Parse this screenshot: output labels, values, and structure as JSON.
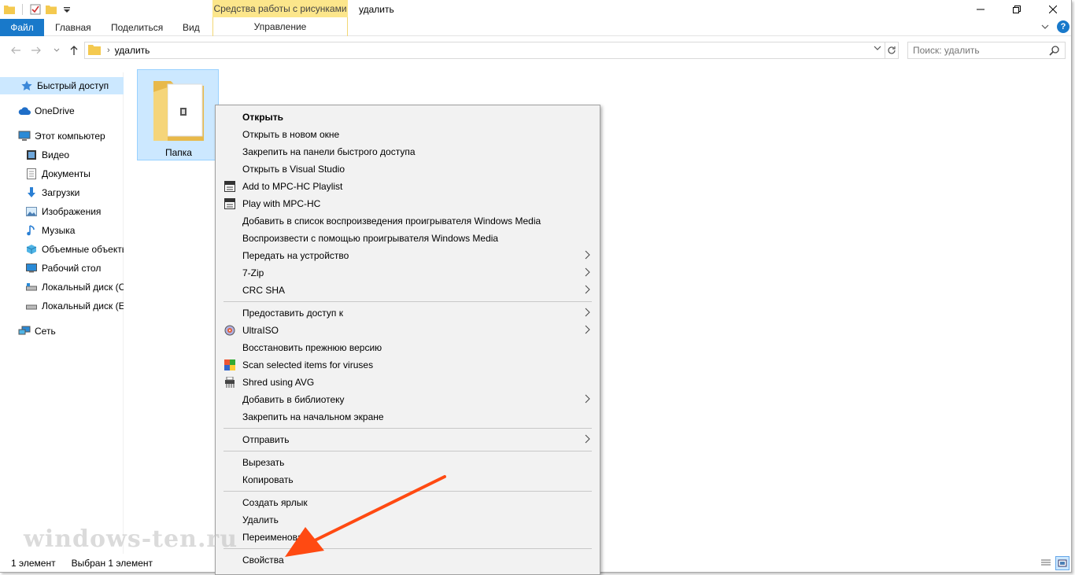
{
  "colors": {
    "accent": "#1979ca",
    "context_tab": "#fce68b",
    "selection": "#cce8ff",
    "menu_bg": "#f2f2f2",
    "annotation_arrow": "#ff4a12"
  },
  "titlebar": {
    "qat_icons": [
      "folder-icon",
      "properties-checkmark-icon",
      "new-folder-icon",
      "customize-qat-dropdown-icon"
    ],
    "context_tab_group": "Средства работы с рисунками",
    "title": "удалить",
    "window_buttons": [
      "minimize-icon",
      "maximize-icon",
      "close-icon"
    ]
  },
  "ribbon": {
    "file_tab": "Файл",
    "tabs": [
      "Главная",
      "Поделиться",
      "Вид"
    ],
    "context_tab": "Управление"
  },
  "address_bar": {
    "path": "удалить",
    "search_placeholder": "Поиск: удалить"
  },
  "sidebar": {
    "items": [
      {
        "label": "Быстрый доступ",
        "icon": "star-icon"
      },
      {
        "label": "OneDrive",
        "icon": "cloud-icon"
      },
      {
        "label": "Этот компьютер",
        "icon": "computer-icon"
      },
      {
        "label": "Видео",
        "icon": "video-icon"
      },
      {
        "label": "Документы",
        "icon": "documents-icon"
      },
      {
        "label": "Загрузки",
        "icon": "downloads-icon"
      },
      {
        "label": "Изображения",
        "icon": "pictures-icon"
      },
      {
        "label": "Музыка",
        "icon": "music-icon"
      },
      {
        "label": "Объемные объекты",
        "icon": "3d-objects-icon"
      },
      {
        "label": "Рабочий стол",
        "icon": "desktop-icon"
      },
      {
        "label": "Локальный диск (C:)",
        "icon": "drive-icon"
      },
      {
        "label": "Локальный диск (E:)",
        "icon": "drive-icon"
      },
      {
        "label": "Сеть",
        "icon": "network-icon"
      }
    ]
  },
  "content": {
    "items": [
      {
        "name": "Папка",
        "icon": "folder-icon",
        "selected": true
      }
    ]
  },
  "context_menu": {
    "items": [
      {
        "label": "Открыть",
        "bold": true
      },
      {
        "label": "Открыть в новом окне"
      },
      {
        "label": "Закрепить на панели быстрого доступа"
      },
      {
        "label": "Открыть в Visual Studio"
      },
      {
        "label": "Add to MPC-HC Playlist",
        "icon": "mpc-hc-icon"
      },
      {
        "label": "Play with MPC-HC",
        "icon": "mpc-hc-icon"
      },
      {
        "label": "Добавить в список воспроизведения проигрывателя Windows Media"
      },
      {
        "label": "Воспроизвести с помощью проигрывателя Windows Media"
      },
      {
        "label": "Передать на устройство",
        "submenu": true
      },
      {
        "label": "7-Zip",
        "submenu": true
      },
      {
        "label": "CRC SHA",
        "submenu": true
      },
      {
        "label": "Предоставить доступ к",
        "submenu": true
      },
      {
        "label": "UltraISO",
        "submenu": true,
        "icon": "ultraiso-icon"
      },
      {
        "label": "Восстановить прежнюю версию"
      },
      {
        "label": "Scan selected items for viruses",
        "icon": "avg-icon"
      },
      {
        "label": "Shred using AVG",
        "icon": "shredder-icon"
      },
      {
        "label": "Добавить в библиотеку",
        "submenu": true
      },
      {
        "label": "Закрепить на начальном экране"
      },
      {
        "label": "Отправить",
        "submenu": true
      },
      {
        "label": "Вырезать"
      },
      {
        "label": "Копировать"
      },
      {
        "label": "Создать ярлык"
      },
      {
        "label": "Удалить"
      },
      {
        "label": "Переименовать"
      },
      {
        "label": "Свойства"
      }
    ]
  },
  "statusbar": {
    "count": "1 элемент",
    "selection": "Выбран 1 элемент",
    "view_buttons": [
      "details-view-icon",
      "large-icons-view-icon"
    ]
  },
  "watermark": "windows-ten.ru"
}
